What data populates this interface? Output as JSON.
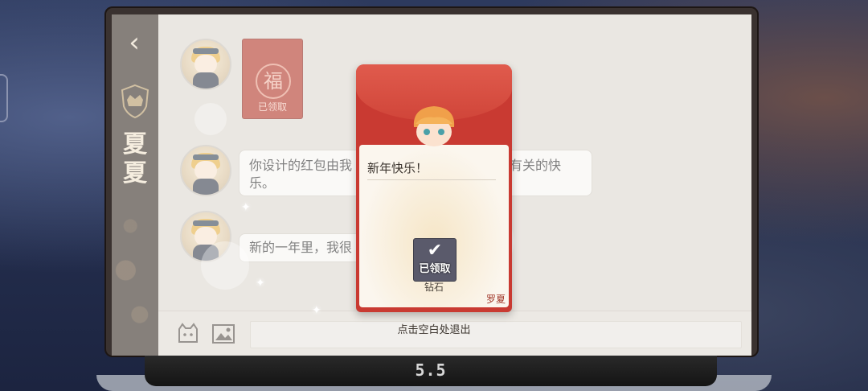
{
  "sidebar": {
    "back_icon": "chevron-left-icon",
    "badge_icon": "crown-shield-icon",
    "contact_name_line1": "夏",
    "contact_name_line2": "夏"
  },
  "chat": {
    "packet_message": {
      "seal_char": "福",
      "status": "已领取"
    },
    "messages": [
      {
        "text": "你设计的红包由我",
        "text_tail": "有关的快",
        "text_line2": "乐。"
      },
      {
        "text": "新的一年里，我很"
      }
    ]
  },
  "bottom_bar": {
    "sticker_icon": "cat-face-icon",
    "image_icon": "image-icon",
    "exit_hint": "点击空白处退出"
  },
  "red_envelope": {
    "greeting": "新年快乐！",
    "reward_status": "已领取",
    "reward_name": "钻石",
    "sender": "罗夏",
    "reward_icon": "check-icon"
  },
  "laptop_logo": "5.5",
  "colors": {
    "envelope_red": "#c93a32",
    "sidebar_brown": "#3c322a",
    "card_cream": "#fbf6ee"
  }
}
